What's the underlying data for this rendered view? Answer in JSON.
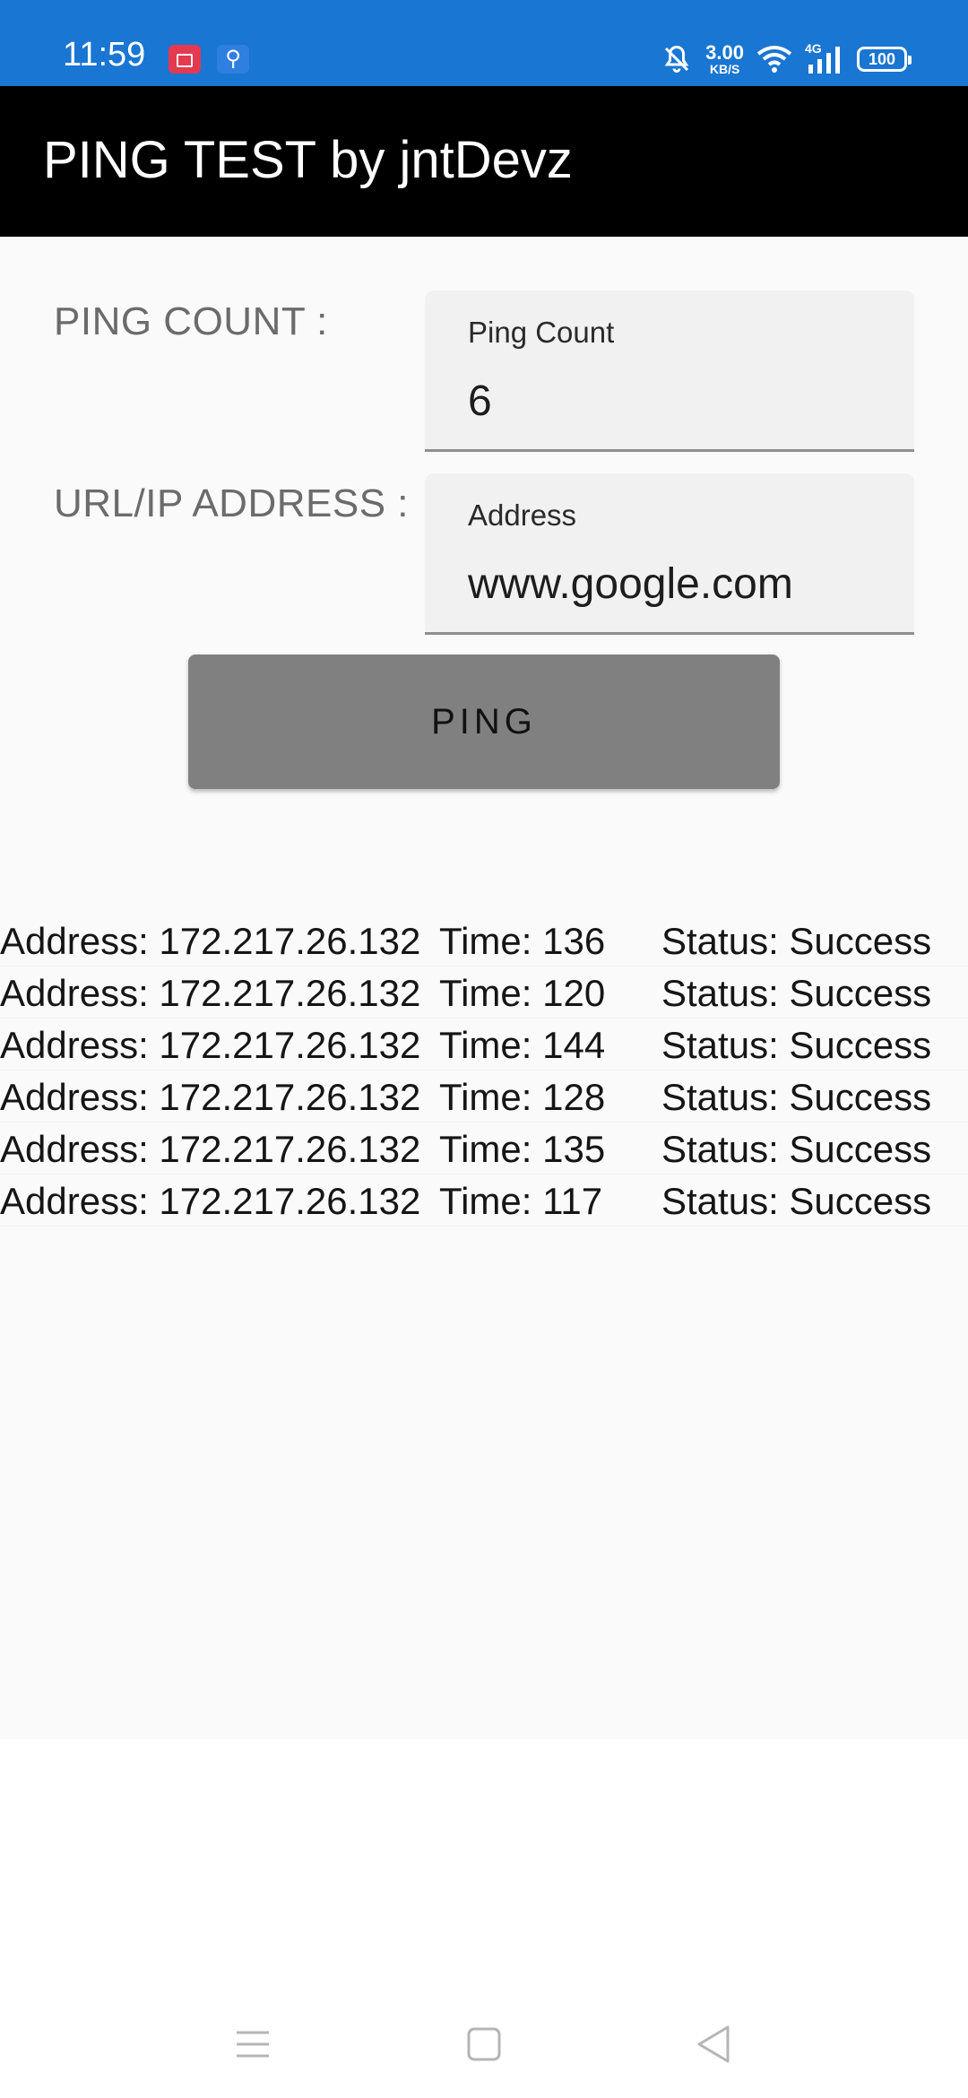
{
  "status_bar": {
    "time": "11:59",
    "speed_value": "3.00",
    "speed_unit": "KB/S",
    "network": "4G",
    "battery": "100",
    "icons": [
      "screen-record-icon",
      "usb-icon",
      "bell-off-icon",
      "wifi-icon",
      "signal-icon",
      "battery-icon"
    ],
    "bg_color": "#1976d2"
  },
  "app_bar": {
    "title": "PING TEST by jntDevz",
    "bg_color": "#000000"
  },
  "form": {
    "ping_count_label": "PING COUNT :",
    "ping_count_field_label": "Ping Count",
    "ping_count_value": "6",
    "url_label": "URL/IP ADDRESS :",
    "address_field_label": "Address",
    "address_value": "www.google.com",
    "ping_button_label": "PING"
  },
  "results": [
    {
      "address": "Address: 172.217.26.132",
      "time": "Time: 136",
      "status": "Status: Success"
    },
    {
      "address": "Address: 172.217.26.132",
      "time": "Time: 120",
      "status": "Status: Success"
    },
    {
      "address": "Address: 172.217.26.132",
      "time": "Time: 144",
      "status": "Status: Success"
    },
    {
      "address": "Address: 172.217.26.132",
      "time": "Time: 128",
      "status": "Status: Success"
    },
    {
      "address": "Address: 172.217.26.132",
      "time": "Time: 135",
      "status": "Status: Success"
    },
    {
      "address": "Address: 172.217.26.132",
      "time": "Time: 117",
      "status": "Status: Success"
    }
  ],
  "nav_bar": {
    "icons": [
      "menu-icon",
      "home-icon",
      "back-icon"
    ]
  }
}
